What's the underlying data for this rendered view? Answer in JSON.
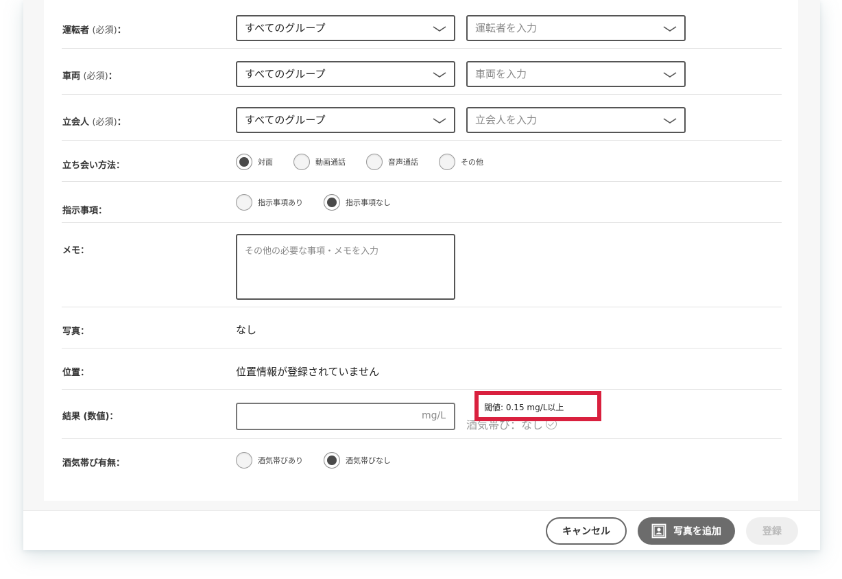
{
  "form": {
    "driver": {
      "label": "運転者",
      "required": "(必須)",
      "colon": "：",
      "group_value": "すべてのグループ",
      "placeholder": "運転者を入力"
    },
    "vehicle": {
      "label": "車両",
      "required": "(必須)",
      "colon": "：",
      "group_value": "すべてのグループ",
      "placeholder": "車両を入力"
    },
    "witness": {
      "label": "立会人",
      "required": "(必須)",
      "colon": "：",
      "group_value": "すべてのグループ",
      "placeholder": "立会人を入力"
    },
    "method": {
      "label": "立ち会い方法：",
      "options": [
        "対面",
        "動画通話",
        "音声通話",
        "その他"
      ],
      "selected": "対面"
    },
    "instruction": {
      "label": "指示事項：",
      "options": [
        "指示事項あり",
        "指示事項なし"
      ],
      "selected": "指示事項なし"
    },
    "memo": {
      "label": "メモ：",
      "placeholder": "その他の必要な事項・メモを入力"
    },
    "photo": {
      "label": "写真：",
      "value": "なし"
    },
    "location": {
      "label": "位置：",
      "value": "位置情報が登録されていません"
    },
    "result": {
      "label": "結果 (数値)：",
      "unit": "mg/L",
      "status": "酒気帯び：なし",
      "threshold": "閾値: 0.15 mg/L以上"
    },
    "alcohol": {
      "label": "酒気帯び有無：",
      "options": [
        "酒気帯びあり",
        "酒気帯びなし"
      ],
      "selected": "酒気帯びなし"
    }
  },
  "footer": {
    "cancel_label": "キャンセル",
    "add_photo_label": "写真を追加",
    "submit_label": "登録"
  },
  "colors": {
    "highlight_border": "#d9203e",
    "radio_selected": "#4a4a4a",
    "primary_button": "#6c6c6c"
  },
  "icons": {
    "select_chevron": "chevron-down-icon",
    "status_check": "check-circle-icon",
    "add_photo": "portrait-photo-icon"
  }
}
